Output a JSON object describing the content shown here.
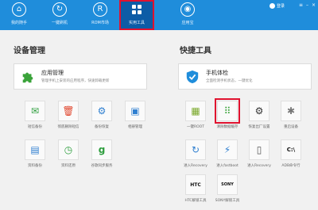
{
  "nav": {
    "items": [
      {
        "label": "我的随手",
        "icon": "home-icon",
        "glyph": "⌂"
      },
      {
        "label": "一键刷机",
        "icon": "refresh-icon",
        "glyph": "↻"
      },
      {
        "label": "ROM市场",
        "icon": "rom-icon",
        "glyph": "R"
      },
      {
        "label": "实用工具",
        "icon": "grid-icon",
        "glyph": ""
      },
      {
        "label": "应用宝",
        "icon": "store-icon",
        "glyph": "◉"
      }
    ],
    "account_label": "登录"
  },
  "left": {
    "title": "设备管理",
    "feature": {
      "title": "应用管理",
      "desc": "管理手机上安装的应用程序，快速卸载更新",
      "icon": "puzzle-icon"
    },
    "tiles": [
      {
        "label": "短信备份",
        "icon": "sms-icon",
        "glyph": "✉"
      },
      {
        "label": "彻底删除短信",
        "icon": "trash-icon",
        "glyph": "🗑"
      },
      {
        "label": "备份恢复",
        "icon": "backup-icon",
        "glyph": "⚙"
      },
      {
        "label": "相册管理",
        "icon": "photo-icon",
        "glyph": "▣"
      },
      {
        "label": "资料备份",
        "icon": "file-icon",
        "glyph": "▤"
      },
      {
        "label": "资料还原",
        "icon": "restore-icon",
        "glyph": "◷"
      },
      {
        "label": "谷歌同步服务",
        "icon": "google-icon",
        "glyph": "g"
      }
    ]
  },
  "right": {
    "title": "快捷工具",
    "feature": {
      "title": "手机体检",
      "desc": "全面检测手机状态，一键优化",
      "icon": "shield-icon"
    },
    "tiles": [
      {
        "label": "一键ROOT",
        "icon": "root-icon",
        "glyph": "▦"
      },
      {
        "label": "清除数据缓存",
        "icon": "dots-grid-icon",
        "glyph": "⠿"
      },
      {
        "label": "恢复出厂设置",
        "icon": "gears-icon",
        "glyph": "⚙"
      },
      {
        "label": "重启设备",
        "icon": "spinner-icon",
        "glyph": "✱"
      },
      {
        "label": "进入Recovery",
        "icon": "reboot-icon",
        "glyph": "↻"
      },
      {
        "label": "进入fastboot",
        "icon": "bolt-icon",
        "glyph": "⚡"
      },
      {
        "label": "进入Recovery",
        "icon": "doc-icon",
        "glyph": "▯"
      },
      {
        "label": "ADB命令行",
        "icon": "terminal-icon",
        "glyph": "C:\\"
      },
      {
        "label": "HTC解锁工具",
        "icon": "htc-icon",
        "glyph": "HTC"
      },
      {
        "label": "SONY解锁工具",
        "icon": "sony-icon",
        "glyph": "SONY"
      }
    ]
  }
}
